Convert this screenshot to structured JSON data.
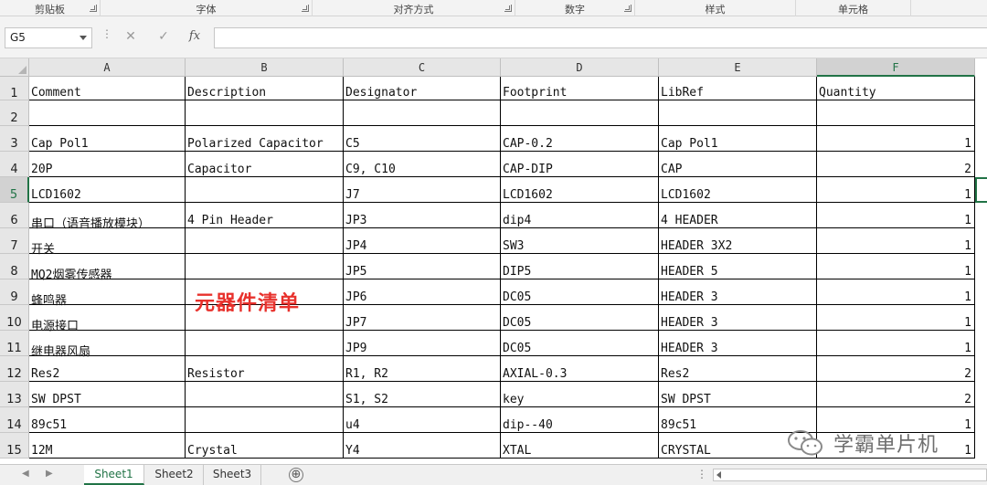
{
  "ribbon_groups": [
    {
      "label": "剪贴板",
      "launcher": true
    },
    {
      "label": "字体",
      "launcher": true
    },
    {
      "label": "对齐方式",
      "launcher": true
    },
    {
      "label": "数字",
      "launcher": true
    },
    {
      "label": "样式",
      "launcher": false
    },
    {
      "label": "单元格",
      "launcher": false
    }
  ],
  "formula_bar": {
    "name_box": "G5",
    "cancel_icon": "✕",
    "enter_icon": "✓",
    "fx_label": "fx",
    "formula": ""
  },
  "columns": [
    "A",
    "B",
    "C",
    "D",
    "E",
    "F"
  ],
  "selected_column": "F",
  "selected_row": "5",
  "rows": [
    {
      "num": "1",
      "cells": [
        "Comment",
        "Description",
        "Designator",
        "Footprint",
        "LibRef",
        "Quantity"
      ]
    },
    {
      "num": "2",
      "cells": [
        "",
        "",
        "",
        "",
        "",
        ""
      ]
    },
    {
      "num": "3",
      "cells": [
        "Cap Pol1",
        "Polarized Capacitor",
        "C5",
        "CAP-0.2",
        "Cap Pol1",
        "1"
      ]
    },
    {
      "num": "4",
      "cells": [
        "20P",
        "Capacitor",
        "C9, C10",
        "CAP-DIP",
        "CAP",
        "2"
      ]
    },
    {
      "num": "5",
      "cells": [
        "LCD1602",
        "",
        "J7",
        "LCD1602",
        "LCD1602",
        "1"
      ]
    },
    {
      "num": "6",
      "cells": [
        "串口（语音播放模块）",
        "4 Pin Header",
        "JP3",
        "dip4",
        "4 HEADER",
        "1"
      ]
    },
    {
      "num": "7",
      "cells": [
        "开关",
        "",
        "JP4",
        "SW3",
        "HEADER 3X2",
        "1"
      ]
    },
    {
      "num": "8",
      "cells": [
        "MQ2烟雾传感器",
        "",
        "JP5",
        "DIP5",
        "HEADER 5",
        "1"
      ]
    },
    {
      "num": "9",
      "cells": [
        "蜂鸣器",
        "",
        "JP6",
        "DC05",
        "HEADER 3",
        "1"
      ]
    },
    {
      "num": "10",
      "cells": [
        "电源接口",
        "",
        "JP7",
        "DC05",
        "HEADER 3",
        "1"
      ]
    },
    {
      "num": "11",
      "cells": [
        "继电器风扇",
        "",
        "JP9",
        "DC05",
        "HEADER 3",
        "1"
      ]
    },
    {
      "num": "12",
      "cells": [
        "Res2",
        "Resistor",
        "R1, R2",
        "AXIAL-0.3",
        "Res2",
        "2"
      ]
    },
    {
      "num": "13",
      "cells": [
        "SW DPST",
        "",
        "S1, S2",
        "key",
        "SW DPST",
        "2"
      ]
    },
    {
      "num": "14",
      "cells": [
        "89c51",
        "",
        "u4",
        "dip--40",
        "89c51",
        "1"
      ]
    },
    {
      "num": "15",
      "cells": [
        "12M",
        "Crystal",
        "Y4",
        "XTAL",
        "CRYSTAL",
        "1"
      ]
    }
  ],
  "overlay_text": "元器件清单",
  "watermark": {
    "text": "学霸单片机",
    "icon": "wechat-icon"
  },
  "sheets": [
    "Sheet1",
    "Sheet2",
    "Sheet3"
  ],
  "active_sheet": "Sheet1",
  "add_sheet_label": "⊕",
  "colors": {
    "accent": "#217346",
    "overlay": "#e8312c"
  }
}
